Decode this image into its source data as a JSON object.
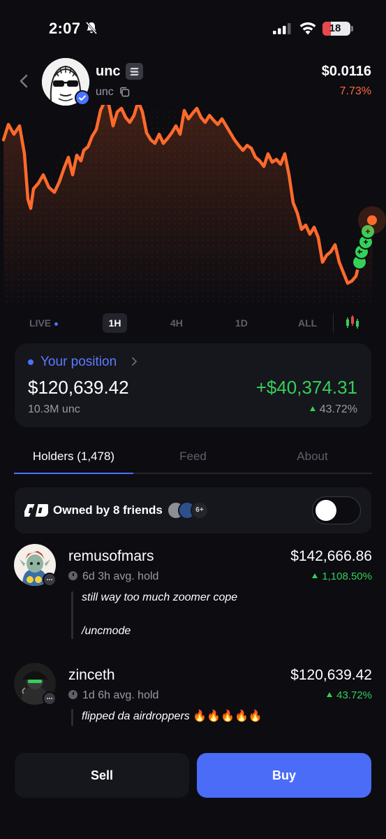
{
  "status_bar": {
    "time": "2:07",
    "battery": "18"
  },
  "token": {
    "name": "unc",
    "ticker": "unc",
    "price": "$0.0116",
    "change": "7.73%"
  },
  "timeframes": {
    "live": "LIVE",
    "h1": "1H",
    "h4": "4H",
    "d1": "1D",
    "all": "ALL",
    "selected": "1H"
  },
  "position": {
    "label": "Your position",
    "value": "$120,639.42",
    "amount": "10.3M unc",
    "pnl": "+$40,374.31",
    "pnl_pct": "43.72%"
  },
  "tabs": {
    "holders": "Holders (1,478)",
    "feed": "Feed",
    "about": "About"
  },
  "friends": {
    "label": "Owned by 8 friends",
    "more": "6+",
    "toggle_on": false
  },
  "holders": [
    {
      "name": "remusofmars",
      "hold": "6d 3h avg. hold",
      "value": "$142,666.86",
      "pct": "1,108.50%",
      "quote_1": "still way too much zoomer cope",
      "quote_2": "/uncmode"
    },
    {
      "name": "zinceth",
      "hold": "1d 6h avg. hold",
      "value": "$120,639.42",
      "pct": "43.72%",
      "quote_1": "flipped da airdroppers",
      "quote_emoji": "🔥🔥🔥🔥🔥"
    }
  ],
  "actions": {
    "sell": "Sell",
    "buy": "Buy"
  },
  "colors": {
    "accent": "#4a73ff",
    "positive": "#34d058",
    "negative": "#ff6a3d",
    "chart_line": "#ff6a2b"
  }
}
